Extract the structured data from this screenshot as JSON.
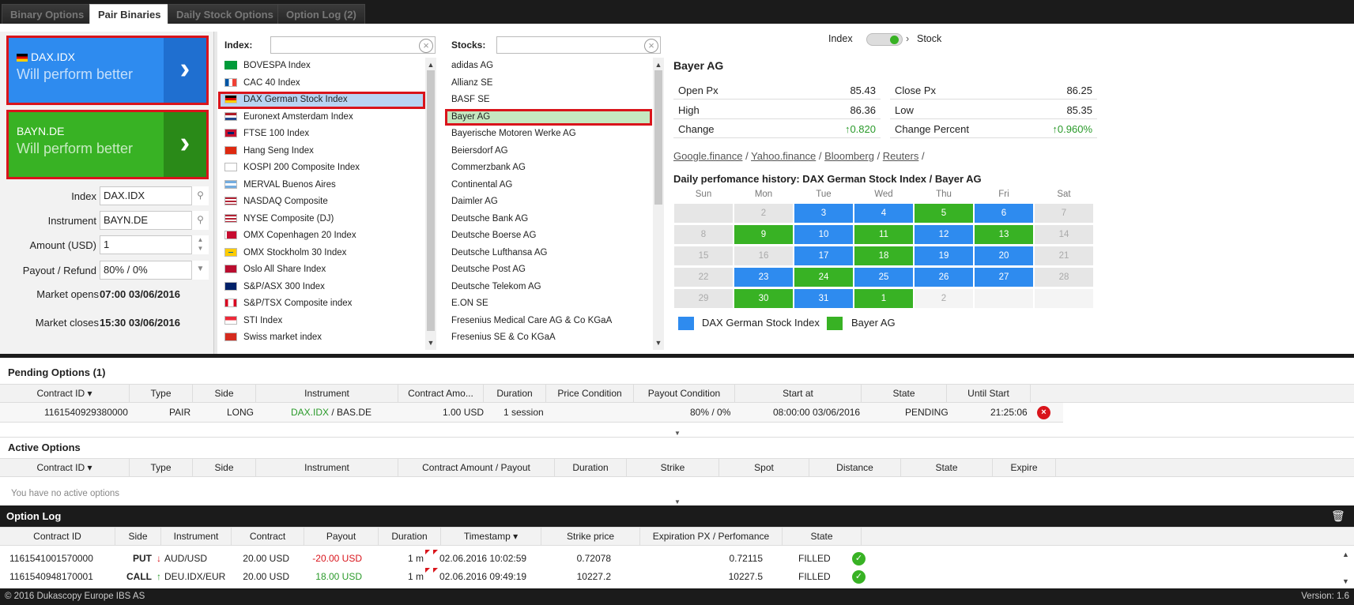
{
  "tabs": [
    "Binary Options",
    "Pair Binaries",
    "Daily Stock Options",
    "Option Log (2)"
  ],
  "active_tab": 1,
  "card1": {
    "symbol": "DAX.IDX",
    "subtitle": "Will perform better",
    "arrow": "›",
    "color": "#2e8bef"
  },
  "card2": {
    "symbol": "BAYN.DE",
    "subtitle": "Will perform better",
    "arrow": "›",
    "color": "#38b224"
  },
  "form": {
    "index_label": "Index",
    "index_value": "DAX.IDX",
    "instrument_label": "Instrument",
    "instrument_value": "BAYN.DE",
    "amount_label": "Amount (USD)",
    "amount_value": "1",
    "payout_label": "Payout / Refund",
    "payout_value": "80% / 0%",
    "opens_label": "Market opens",
    "opens_value": "07:00 03/06/2016",
    "closes_label": "Market closes",
    "closes_value": "15:30 03/06/2016"
  },
  "index_list": {
    "label": "Index:",
    "items": [
      "BOVESPA Index",
      "CAC 40 Index",
      "DAX German Stock Index",
      "Euronext Amsterdam Index",
      "FTSE 100 Index",
      "Hang Seng Index",
      "KOSPI 200 Composite Index",
      "MERVAL Buenos Aires",
      "NASDAQ Composite",
      "NYSE Composite (DJ)",
      "OMX Copenhagen 20 Index",
      "OMX Stockholm 30 Index",
      "Oslo All Share Index",
      "S&P/ASX 300 Index",
      "S&P/TSX Composite index",
      "STI Index",
      "Swiss market index"
    ],
    "selected": 2
  },
  "stock_list": {
    "label": "Stocks:",
    "items": [
      "adidas AG",
      "Allianz SE",
      "BASF SE",
      "Bayer AG",
      "Bayerische Motoren Werke AG",
      "Beiersdorf AG",
      "Commerzbank AG",
      "Continental AG",
      "Daimler AG",
      "Deutsche Bank AG",
      "Deutsche Boerse AG",
      "Deutsche Lufthansa AG",
      "Deutsche Post AG",
      "Deutsche Telekom AG",
      "E.ON SE",
      "Fresenius Medical Care AG & Co KGaA",
      "Fresenius SE & Co KGaA"
    ],
    "selected": 3
  },
  "toggle": {
    "left": "Index",
    "right": "Stock"
  },
  "details": {
    "title": "Bayer AG",
    "open_label": "Open Px",
    "open_value": "85.43",
    "close_label": "Close Px",
    "close_value": "86.25",
    "high_label": "High",
    "high_value": "86.36",
    "low_label": "Low",
    "low_value": "85.35",
    "change_label": "Change",
    "change_value": "0.820",
    "changepct_label": "Change Percent",
    "changepct_value": "0.960%",
    "links": [
      "Google.finance",
      "Yahoo.finance",
      "Bloomberg",
      "Reuters"
    ]
  },
  "calendar": {
    "title": "Daily perfomance history: DAX German Stock Index / Bayer AG",
    "days": [
      "Sun",
      "Mon",
      "Tue",
      "Wed",
      "Thu",
      "Fri",
      "Sat"
    ],
    "weeks": [
      [
        [
          "",
          "g"
        ],
        [
          "2",
          "g"
        ],
        [
          "3",
          "b"
        ],
        [
          "4",
          "b"
        ],
        [
          "5",
          "G"
        ],
        [
          "6",
          "b"
        ],
        [
          "7",
          "g"
        ]
      ],
      [
        [
          "8",
          "g"
        ],
        [
          "9",
          "G"
        ],
        [
          "10",
          "b"
        ],
        [
          "11",
          "G"
        ],
        [
          "12",
          "b"
        ],
        [
          "13",
          "G"
        ],
        [
          "14",
          "g"
        ]
      ],
      [
        [
          "15",
          "g"
        ],
        [
          "16",
          "g"
        ],
        [
          "17",
          "b"
        ],
        [
          "18",
          "G"
        ],
        [
          "19",
          "b"
        ],
        [
          "20",
          "b"
        ],
        [
          "21",
          "g"
        ]
      ],
      [
        [
          "22",
          "g"
        ],
        [
          "23",
          "b"
        ],
        [
          "24",
          "G"
        ],
        [
          "25",
          "b"
        ],
        [
          "26",
          "b"
        ],
        [
          "27",
          "b"
        ],
        [
          "28",
          "g"
        ]
      ],
      [
        [
          "29",
          "g"
        ],
        [
          "30",
          "G"
        ],
        [
          "31",
          "b"
        ],
        [
          "1",
          "G"
        ],
        [
          "2",
          "e"
        ],
        [
          "",
          "e"
        ],
        [
          "",
          "e"
        ]
      ]
    ],
    "legend_blue": "DAX German Stock Index",
    "legend_green": "Bayer AG"
  },
  "pending": {
    "title": "Pending Options (1)",
    "headers": [
      "Contract ID ▾",
      "Type",
      "Side",
      "Instrument",
      "Contract Amo...",
      "Duration",
      "Price Condition",
      "Payout Condition",
      "Start at",
      "State",
      "Until Start"
    ],
    "row": {
      "id": "1161540929380000",
      "type": "PAIR",
      "side": "LONG",
      "inst1": "DAX.IDX",
      "inst_sep": " / ",
      "inst2": "BAS.DE",
      "amount": "1.00 USD",
      "duration": "1 session",
      "price_cond": "",
      "payout_cond": "80% / 0%",
      "start": "08:00:00 03/06/2016",
      "state": "PENDING",
      "until": "21:25:06"
    }
  },
  "active": {
    "title": "Active Options",
    "headers": [
      "Contract ID ▾",
      "Type",
      "Side",
      "Instrument",
      "Contract Amount / Payout",
      "Duration",
      "Strike",
      "Spot",
      "Distance",
      "State",
      "Expire"
    ],
    "empty": "You have no active options"
  },
  "log": {
    "title": "Option Log",
    "headers": [
      "Contract ID",
      "Side",
      "Instrument",
      "Contract",
      "Payout",
      "Duration",
      "Timestamp ▾",
      "Strike price",
      "Expiration PX / Perfomance",
      "State"
    ],
    "rows": [
      {
        "id": "1161541001570000",
        "side": "PUT",
        "arrow": "↓",
        "inst": "AUD/USD",
        "contract": "20.00 USD",
        "payout": "-20.00 USD",
        "duration": "1 m",
        "ts": "02.06.2016 10:02:59",
        "strike": "0.72078",
        "exp": "0.72115",
        "state": "FILLED"
      },
      {
        "id": "1161540948170001",
        "side": "CALL",
        "arrow": "↑",
        "inst": "DEU.IDX/EUR",
        "contract": "20.00 USD",
        "payout": "18.00 USD",
        "duration": "1 m",
        "ts": "02.06.2016 09:49:19",
        "strike": "10227.2",
        "exp": "10227.5",
        "state": "FILLED"
      }
    ]
  },
  "footer": {
    "copyright": "© 2016 Dukascopy Europe IBS AS",
    "version": "Version: 1.6"
  }
}
